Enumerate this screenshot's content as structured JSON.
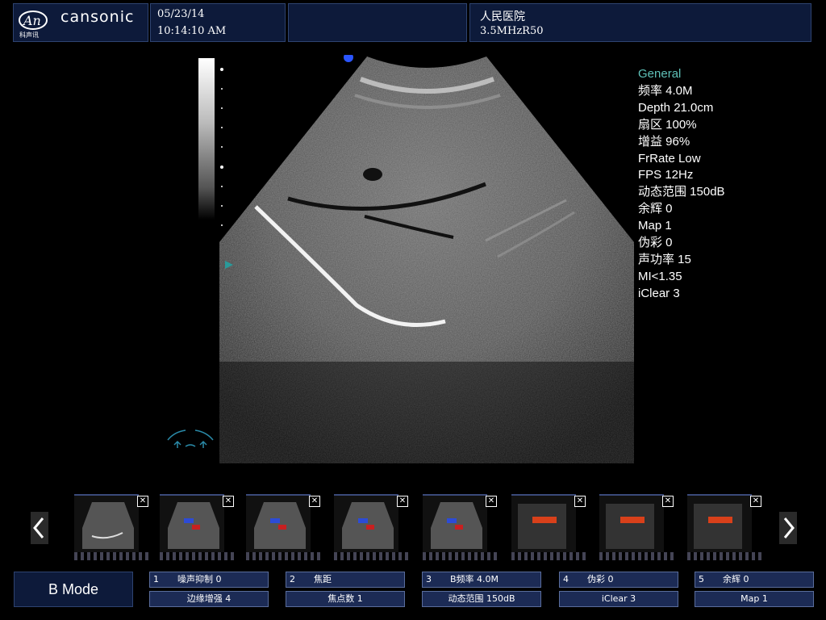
{
  "header": {
    "logo_brand": "cansonic",
    "logo_sub": "科声讯",
    "date": "05/23/14",
    "time": "10:14:10 AM",
    "hospital": "人民医院",
    "probe": "3.5MHzR50"
  },
  "params": {
    "title": "General",
    "rows": [
      "频率 4.0M",
      "Depth 21.0cm",
      "扇区 100%",
      "增益 96%",
      "FrRate Low",
      "FPS 12Hz",
      "动态范围 150dB",
      "余辉 0",
      "Map 1",
      "伪彩 0",
      "声功率 15",
      "MI<1.35",
      "iClear 3"
    ]
  },
  "thumbnails": {
    "close_glyph": "✕",
    "items": [
      {
        "kind": "bmode"
      },
      {
        "kind": "color"
      },
      {
        "kind": "color"
      },
      {
        "kind": "color"
      },
      {
        "kind": "color"
      },
      {
        "kind": "doppler"
      },
      {
        "kind": "doppler"
      },
      {
        "kind": "doppler"
      }
    ]
  },
  "mode_button": "B Mode",
  "controls": [
    {
      "num": "1",
      "top": "噪声抑制 0",
      "bottom": "边缘增强 4"
    },
    {
      "num": "2",
      "top": "焦距",
      "bottom": "焦点数 1"
    },
    {
      "num": "3",
      "top": "B频率 4.0M",
      "bottom": "动态范围  150dB"
    },
    {
      "num": "4",
      "top": "伪彩 0",
      "bottom": "iClear  3"
    },
    {
      "num": "5",
      "top": "余辉 0",
      "bottom": "Map  1"
    }
  ],
  "colors": {
    "header_bg": "#0d1a3a",
    "accent_teal": "#5fc1b8",
    "control_bg": "#1c2b55"
  }
}
